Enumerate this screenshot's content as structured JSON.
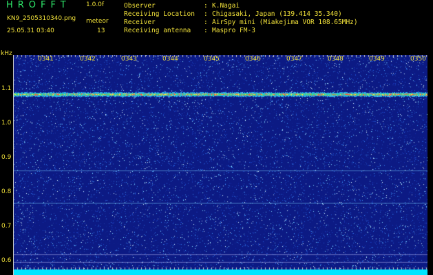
{
  "header": {
    "app_title": "HROFFT",
    "version": "1.0.0f",
    "filename": "KN9_2505310340.png",
    "meteor_label": "meteor",
    "datetime": "25.05.31 03:40",
    "meteor_count": "13",
    "info": [
      {
        "key": "Observer",
        "sep": ":",
        "value": "K.Nagai"
      },
      {
        "key": "Receiving Location",
        "sep": ":",
        "value": "Chigasaki, Japan (139.414 35.340)"
      },
      {
        "key": "Receiver",
        "sep": ":",
        "value": "AirSpy mini (Miakejima VOR 108.65MHz)"
      },
      {
        "key": "Receiving antenna",
        "sep": ":",
        "value": "Maspro FM-3"
      }
    ]
  },
  "spectrogram": {
    "y_unit": "kHz",
    "y_ticks": [
      "1.1",
      "1.0",
      "0.9",
      "0.8",
      "0.7",
      "0.6"
    ],
    "x_ticks": [
      "0341",
      "0342",
      "0343",
      "0344",
      "0345",
      "0346",
      "0347",
      "0348",
      "0349",
      "0350"
    ],
    "colors": {
      "background": "#0c1a84",
      "label": "#f2e23a",
      "band": "#00e5ff"
    }
  }
}
